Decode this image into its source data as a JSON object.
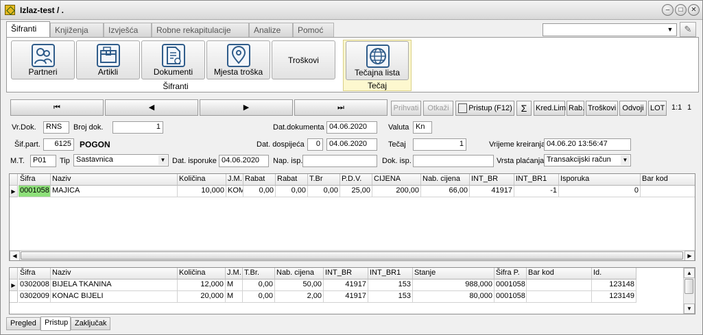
{
  "window": {
    "title": "Izlaz-test / ."
  },
  "ribbon": {
    "tabs": [
      "Šifranti",
      "Knjiženja",
      "Izvješća",
      "Robne rekapitulacije",
      "Analize",
      "Pomoć"
    ],
    "active_tab": "Šifranti",
    "sifranti_group": {
      "label": "Šifranti",
      "buttons": [
        "Partneri",
        "Artikli",
        "Dokumenti",
        "Mjesta troška",
        "Troškovi"
      ]
    },
    "tecaj_group": {
      "label": "Tečaj",
      "buttons": [
        "Tečajna lista"
      ]
    }
  },
  "toolbar": {
    "nav": [
      "first",
      "previous",
      "next",
      "last"
    ],
    "buttons": [
      "Prihvati",
      "Otkaži",
      "Pristup (F12)",
      "Σ",
      "Kred.Lim",
      "Rab.",
      "Troškovi",
      "Odvoji",
      "LOT",
      "1:1",
      "1"
    ]
  },
  "form": {
    "vr_dok_label": "Vr.Dok.",
    "vr_dok": "RNS",
    "broj_dok_label": "Broj dok.",
    "broj_dok": "1",
    "dat_dokumenta_label": "Dat.dokumenta",
    "dat_dokumenta": "04.06.2020",
    "valuta_label": "Valuta",
    "valuta": "Kn",
    "sif_part_label": "Šif.part.",
    "sif_part": "6125",
    "partner_name": "POGON",
    "dat_dospijeca_label": "Dat. dospijeća",
    "dani": "0",
    "dat_dospijeca": "04.06.2020",
    "tecaj_label": "Tečaj",
    "tecaj": "1",
    "vrijeme_kreiranja_label": "Vrijeme kreiranja",
    "vrijeme_kreiranja": "04.06.20 13:56:47",
    "mt_label": "M.T.",
    "mt": "P01",
    "tip_label": "Tip",
    "tip": "Sastavnica",
    "dat_isporuke_label": "Dat. isporuke",
    "dat_isporuke": "04.06.2020",
    "nap_isp_label": "Nap. isp.",
    "nap_isp": "",
    "dok_isp_label": "Dok. isp.",
    "dok_isp": "",
    "vrsta_placanja_label": "Vrsta plaćanja",
    "vrsta_placanja": "Transakcijski račun"
  },
  "grid1": {
    "columns": [
      "Šifra",
      "Naziv",
      "Količina",
      "J.M.",
      "Rabat",
      "Rabat",
      "T.Br",
      "P.D.V.",
      "CIJENA",
      "Nab. cijena",
      "INT_BR",
      "INT_BR1",
      "Isporuka",
      "Bar kod"
    ],
    "rows": [
      [
        "0001058",
        "MAJICA",
        "10,000",
        "KOM",
        "0,00",
        "0,00",
        "0,00",
        "25,00",
        "200,00",
        "66,00",
        "41917",
        "-1",
        "0",
        ""
      ]
    ]
  },
  "grid2": {
    "columns": [
      "Šifra",
      "Naziv",
      "Količina",
      "J.M.",
      "T.Br.",
      "Nab. cijena",
      "INT_BR",
      "INT_BR1",
      "Stanje",
      "Šifra P.",
      "Bar kod",
      "Id."
    ],
    "rows": [
      [
        "0302008",
        "BIJELA TKANINA",
        "12,000",
        "M",
        "0,00",
        "50,00",
        "41917",
        "153",
        "988,000",
        "0001058",
        "",
        "123148"
      ],
      [
        "0302009",
        "KONAC BIJELI",
        "20,000",
        "M",
        "0,00",
        "2,00",
        "41917",
        "153",
        "80,000",
        "0001058",
        "",
        "123149"
      ]
    ]
  },
  "bottom_tabs": [
    "Pregled",
    "Pristup",
    "Zaključak"
  ],
  "active_bottom_tab": "Pristup"
}
